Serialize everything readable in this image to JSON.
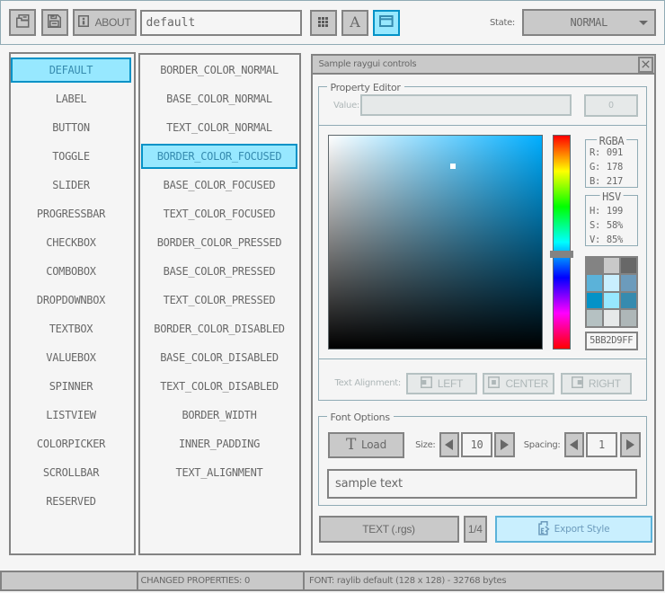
{
  "toolbar": {
    "about_label": "ABOUT",
    "file_name": "default",
    "state_label": "State:",
    "state_value": "NORMAL"
  },
  "style_types": {
    "items": [
      {
        "label": "DEFAULT",
        "selected": true
      },
      {
        "label": "LABEL",
        "selected": false
      },
      {
        "label": "BUTTON",
        "selected": false
      },
      {
        "label": "TOGGLE",
        "selected": false
      },
      {
        "label": "SLIDER",
        "selected": false
      },
      {
        "label": "PROGRESSBAR",
        "selected": false
      },
      {
        "label": "CHECKBOX",
        "selected": false
      },
      {
        "label": "COMBOBOX",
        "selected": false
      },
      {
        "label": "DROPDOWNBOX",
        "selected": false
      },
      {
        "label": "TEXTBOX",
        "selected": false
      },
      {
        "label": "VALUEBOX",
        "selected": false
      },
      {
        "label": "SPINNER",
        "selected": false
      },
      {
        "label": "LISTVIEW",
        "selected": false
      },
      {
        "label": "COLORPICKER",
        "selected": false
      },
      {
        "label": "SCROLLBAR",
        "selected": false
      },
      {
        "label": "RESERVED",
        "selected": false
      }
    ]
  },
  "properties": {
    "items": [
      {
        "label": "BORDER_COLOR_NORMAL",
        "selected": false
      },
      {
        "label": "BASE_COLOR_NORMAL",
        "selected": false
      },
      {
        "label": "TEXT_COLOR_NORMAL",
        "selected": false
      },
      {
        "label": "BORDER_COLOR_FOCUSED",
        "selected": true
      },
      {
        "label": "BASE_COLOR_FOCUSED",
        "selected": false
      },
      {
        "label": "TEXT_COLOR_FOCUSED",
        "selected": false
      },
      {
        "label": "BORDER_COLOR_PRESSED",
        "selected": false
      },
      {
        "label": "BASE_COLOR_PRESSED",
        "selected": false
      },
      {
        "label": "TEXT_COLOR_PRESSED",
        "selected": false
      },
      {
        "label": "BORDER_COLOR_DISABLED",
        "selected": false
      },
      {
        "label": "BASE_COLOR_DISABLED",
        "selected": false
      },
      {
        "label": "TEXT_COLOR_DISABLED",
        "selected": false
      },
      {
        "label": "BORDER_WIDTH",
        "selected": false
      },
      {
        "label": "INNER_PADDING",
        "selected": false
      },
      {
        "label": "TEXT_ALIGNMENT",
        "selected": false
      }
    ]
  },
  "sample_window": {
    "title": "Sample raygui controls",
    "property_editor": {
      "label": "Property Editor",
      "value_label": "Value:",
      "value_text": "",
      "value_button": "0"
    },
    "color_picker": {
      "rgba": {
        "label": "RGBA",
        "rows": [
          {
            "k": "R:",
            "v": "091"
          },
          {
            "k": "G:",
            "v": "178"
          },
          {
            "k": "B:",
            "v": "217"
          }
        ]
      },
      "hsv": {
        "label": "HSV",
        "rows": [
          {
            "k": "H:",
            "v": "199"
          },
          {
            "k": "S:",
            "v": "58%"
          },
          {
            "k": "V:",
            "v": "85%"
          }
        ]
      },
      "palette": [
        "#838383",
        "#c9c9c9",
        "#686868",
        "#5bb2d9",
        "#c9effe",
        "#6c9bbc",
        "#0492c7",
        "#97e8ff",
        "#368baf",
        "#b5c1c2",
        "#e6e9e9",
        "#aeb7b8"
      ],
      "selected_hex": "5BB2D9FF"
    },
    "text_alignment": {
      "label": "Text Alignment:",
      "buttons": [
        "LEFT",
        "CENTER",
        "RIGHT"
      ]
    },
    "font_options": {
      "label": "Font Options",
      "load_label": "Load",
      "size_label": "Size:",
      "size_value": "10",
      "spacing_label": "Spacing:",
      "spacing_value": "1",
      "sample_text": "sample text"
    },
    "export_bar": {
      "format_label": "TEXT (.rgs)",
      "page_label": "1/4",
      "export_label": "Export Style"
    }
  },
  "statusbar": {
    "changed": "CHANGED PROPERTIES: 0",
    "font_info": "FONT: raylib default (128 x 128) - 32768 bytes"
  },
  "colors": {
    "background": "#f5f5f5",
    "border_normal": "#838383",
    "base_normal": "#c9c9c9",
    "text_normal": "#686868",
    "border_focused": "#5bb2d9",
    "base_focused": "#c9effe",
    "text_focused": "#6c9bbc",
    "border_pressed": "#0492c7",
    "base_pressed": "#97e8ff",
    "text_pressed": "#368baf",
    "border_disabled": "#b5c1c2",
    "base_disabled": "#e6e9e9",
    "text_disabled": "#aeb7b8",
    "line": "#90abb5"
  }
}
